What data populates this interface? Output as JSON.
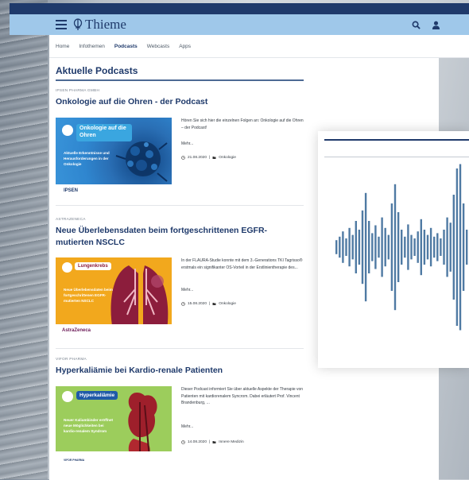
{
  "header": {
    "brand": "Thieme",
    "icons": [
      "menu-icon",
      "search-icon",
      "user-icon"
    ]
  },
  "nav": {
    "items": [
      "Home",
      "Infothemen",
      "Podcasts",
      "Webcasts",
      "Apps"
    ],
    "active": "Podcasts"
  },
  "section": {
    "title": "Aktuelle Podcasts"
  },
  "podcasts": [
    {
      "sponsor": "IPSEN PHARMA GMBH",
      "title": "Onkologie auf die Ohren - der Podcast",
      "thumb_badge": "Onkologie auf die Ohren",
      "thumb_text": "Aktuelle Erkenntnisse und Herausforderungen in der Onkologie",
      "thumb_logo": "IPSEN",
      "description": "Hören Sie sich hier die einzelnen Folgen an: Onkologie auf die Ohren – der Podcast!",
      "more": "Mehr...",
      "date": "21.08.2020",
      "category": "Onkologie"
    },
    {
      "sponsor": "ASTRAZENECA",
      "title": "Neue Überlebensdaten beim fortgeschrittenen EGFR-mutierten NSCLC",
      "thumb_badge": "Lungenkrebs",
      "thumb_text": "Neue Überlebensdaten beim fortgeschrittenen EGFR-mutierten NSCLC",
      "thumb_logo": "AstraZeneca",
      "description": "In der FLAURA-Studie konnte mit dem 3.-Generations TKI Tagrisso® erstmals ein signifikanter OS-Vorteil in der Erstlinientherapie des...",
      "more": "Mehr...",
      "date": "15.08.2020",
      "category": "Onkologie"
    },
    {
      "sponsor": "VIFOR PHARMA",
      "title": "Hyperkaliämie bei Kardio-renale Patienten",
      "thumb_badge": "Hyperkaliämie",
      "thumb_text": "Neuer Kaliumbinder eröffnet neue Möglichkeiten bei kardio-renalem Syndrom",
      "thumb_logo": "VIFOR PHARMA",
      "description": "Dieser Podcast informiert Sie über aktuelle Aspekte der Therapie von Patienten mit kardiorenalem Syncrom. Dabei erläutert Prof. Vincent Brandenburg, ...",
      "more": "Mehr...",
      "date": "14.08.2020",
      "category": "Innere Medizin"
    }
  ],
  "colors": {
    "brand_dark": "#1f3a6b",
    "header_light": "#9fc8ea",
    "waveform": "#4f7aa3"
  },
  "waveform": {
    "amplitudes": [
      0.08,
      0.12,
      0.18,
      0.1,
      0.22,
      0.14,
      0.3,
      0.2,
      0.42,
      0.62,
      0.3,
      0.16,
      0.25,
      0.12,
      0.34,
      0.22,
      0.14,
      0.5,
      0.72,
      0.4,
      0.2,
      0.12,
      0.26,
      0.14,
      0.1,
      0.18,
      0.32,
      0.2,
      0.14,
      0.22,
      0.12,
      0.16,
      0.1,
      0.2,
      0.34,
      0.28,
      0.6,
      0.9,
      0.95,
      0.5,
      0.2,
      0.14
    ]
  }
}
